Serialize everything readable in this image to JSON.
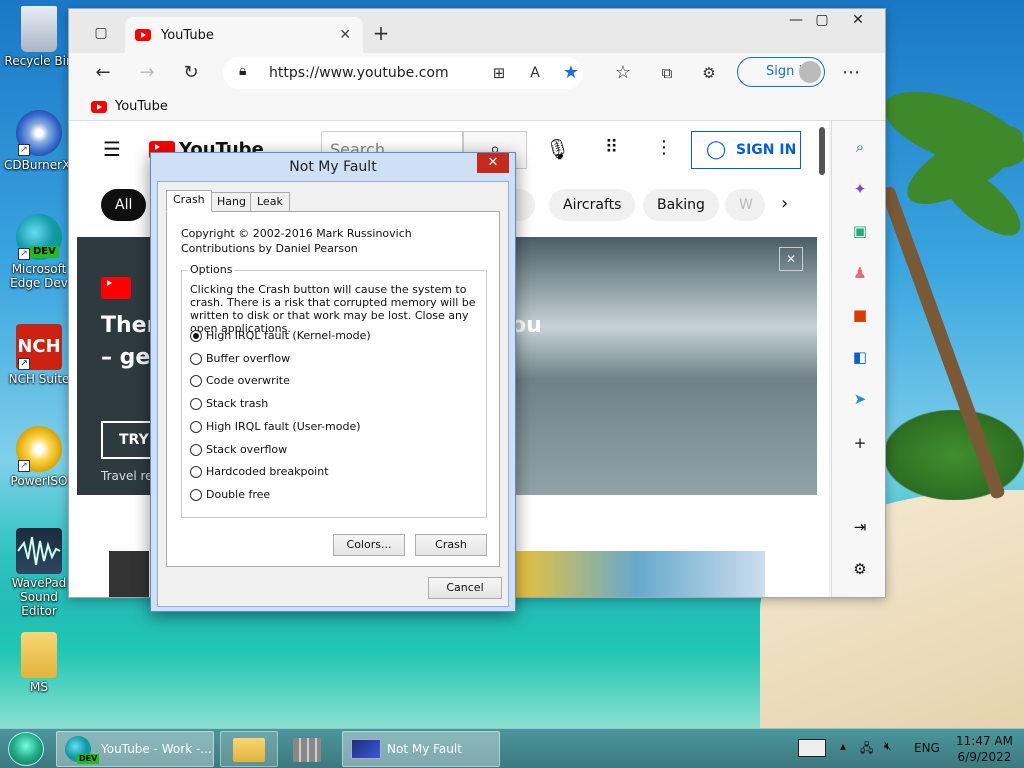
{
  "desktop": {
    "icons": [
      {
        "label": "Recycle Bin"
      },
      {
        "label": "CDBurnerXP"
      },
      {
        "label": "Microsoft Edge Dev"
      },
      {
        "label": "NCH Suite"
      },
      {
        "label": "PowerISO"
      },
      {
        "label": "WavePad Sound Editor"
      },
      {
        "label": "MS"
      }
    ],
    "edge_dev_badge": "DEV"
  },
  "browser": {
    "tab_title": "YouTube",
    "address": "https://www.youtube.com",
    "sign_in": "Sign in",
    "favorites_item": "YouTube",
    "youtube": {
      "logo_text": "YouTube",
      "search_placeholder": "Search",
      "sign_in_button": "SIGN IN",
      "chips": [
        "All",
        "s",
        "Aircrafts",
        "Baking",
        "W"
      ],
      "banner": {
        "heading_line1": "Ther",
        "heading_line1_right": "ou",
        "heading_line2": "– ge",
        "try_button": "TRY",
        "subtext": "Travel re"
      }
    }
  },
  "dialog": {
    "title": "Not My Fault",
    "tabs": [
      "Crash",
      "Hang",
      "Leak"
    ],
    "copyright": "Copyright © 2002-2016 Mark Russinovich",
    "contributions": "Contributions by Daniel Pearson",
    "options_label": "Options",
    "description": "Clicking the Crash button will cause the system to crash. There is a risk that corrupted memory will be written to disk or that work may be lost. Close any open applications.",
    "options": [
      {
        "label": "High IRQL fault (Kernel-mode)",
        "selected": true
      },
      {
        "label": "Buffer overflow",
        "selected": false
      },
      {
        "label": "Code overwrite",
        "selected": false
      },
      {
        "label": "Stack trash",
        "selected": false
      },
      {
        "label": "High IRQL fault (User-mode)",
        "selected": false
      },
      {
        "label": "Stack overflow",
        "selected": false
      },
      {
        "label": "Hardcoded breakpoint",
        "selected": false
      },
      {
        "label": "Double free",
        "selected": false
      }
    ],
    "colors_button": "Colors...",
    "crash_button": "Crash",
    "cancel_button": "Cancel"
  },
  "taskbar": {
    "tasks": [
      {
        "label": "YouTube - Work -..."
      },
      {
        "label": ""
      },
      {
        "label": ""
      },
      {
        "label": "Not My Fault"
      }
    ],
    "edge_badge": "DEV",
    "language": "ENG",
    "time": "11:47 AM",
    "date": "6/9/2022"
  }
}
